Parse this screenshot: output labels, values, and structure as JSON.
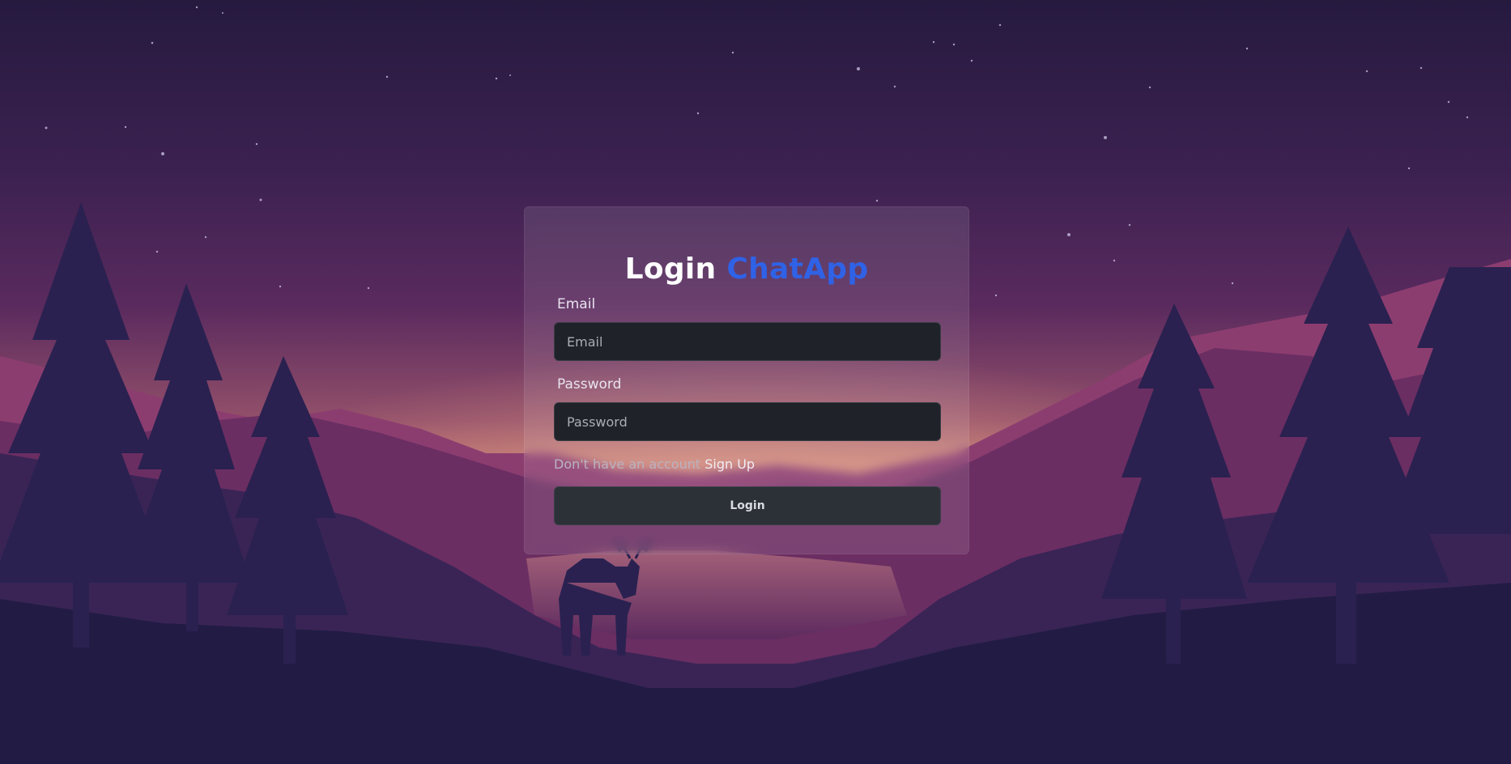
{
  "login_form": {
    "title_prefix": "Login",
    "title_brand": "ChatApp",
    "email_label": "Email",
    "email_placeholder": "Email",
    "email_value": "",
    "password_label": "Password",
    "password_placeholder": "Password",
    "password_value": "",
    "signup_prompt": "Don't have an account",
    "signup_link": "Sign Up",
    "login_button": "Login"
  },
  "colors": {
    "brand": "#2f62e6",
    "input_bg": "#1f2228",
    "button_bg": "#2c3138",
    "sky_top": "#261a3f",
    "sky_horizon": "#c27a73",
    "foreground": "#221c45"
  }
}
